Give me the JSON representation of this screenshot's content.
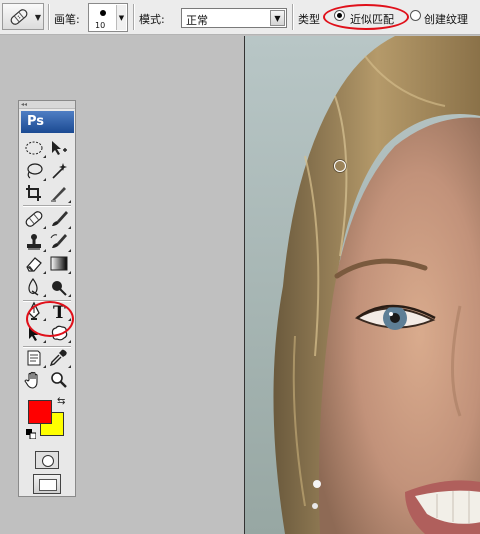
{
  "options_bar": {
    "brush_label": "画笔:",
    "brush_size": "10",
    "mode_label": "模式:",
    "mode_value": "正常",
    "type_label": "类型",
    "option_proximity": "近似匹配",
    "option_texture": "创建纹理",
    "selected_option": "近似匹配"
  },
  "toolbox": {
    "logo": "Ps",
    "highlighted_tool": "healing-brush-tool",
    "foreground_color": "#ff0000",
    "background_color": "#ffff00",
    "tools": [
      "elliptical-marquee-tool",
      "move-tool",
      "lasso-tool",
      "magic-wand-tool",
      "crop-tool",
      "slice-tool",
      "healing-brush-tool",
      "brush-tool",
      "clone-stamp-tool",
      "history-brush-tool",
      "eraser-tool",
      "gradient-tool",
      "blur-tool",
      "burn-tool",
      "pen-tool",
      "type-tool",
      "path-selection-tool",
      "custom-shape-tool",
      "notes-tool",
      "eyedropper-tool",
      "hand-tool",
      "zoom-tool"
    ],
    "type_tool_glyph": "T"
  },
  "canvas": {
    "subject": "close-up photo of a smiling woman's face"
  },
  "colors": {
    "annotation": "#e0101a",
    "panel": "#e8e8e8",
    "workspace": "#c0c0c0"
  }
}
